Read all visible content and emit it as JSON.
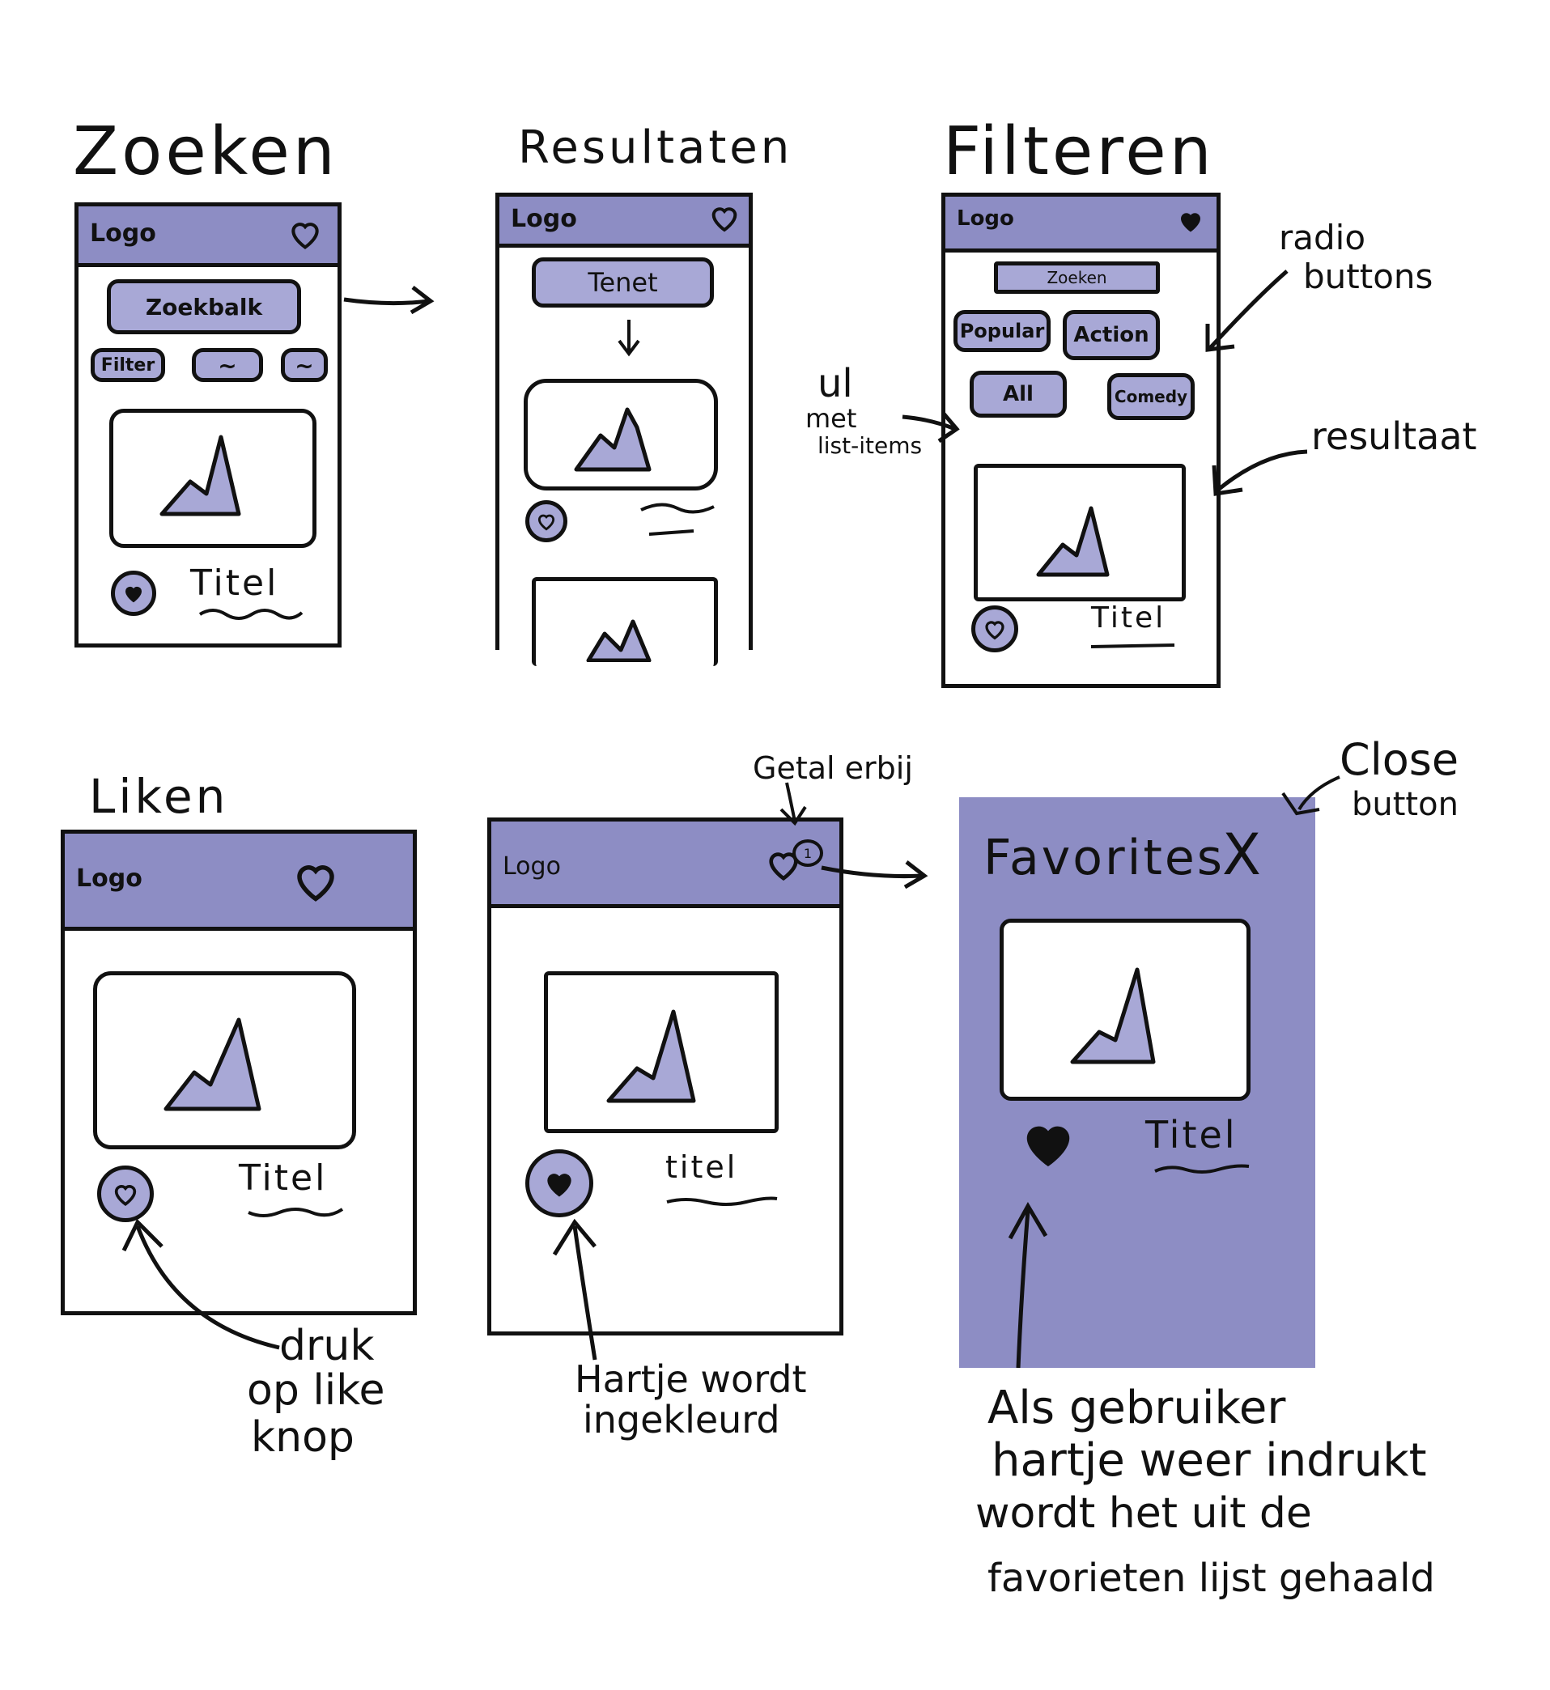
{
  "sections": {
    "zoeken": "Zoeken",
    "resultaten": "Resultaten",
    "filteren": "Filteren",
    "liken": "Liken"
  },
  "common": {
    "logo": "Logo",
    "titel": "Titel"
  },
  "zoeken_screen": {
    "searchbar": "Zoekbalk",
    "filter": "Filter",
    "chip2": "~",
    "chip3": "~"
  },
  "resultaten_screen": {
    "search_value": "Tenet"
  },
  "filteren_screen": {
    "search": "Zoeken",
    "radios": [
      "Popular",
      "Action",
      "All",
      "Comedy"
    ]
  },
  "liked_screen": {
    "titel": "titel"
  },
  "favorites_screen": {
    "title": "Favorites",
    "close": "X"
  },
  "annotations": {
    "radio_buttons": [
      "radio",
      "buttons"
    ],
    "ul": [
      "ul",
      "met",
      "list-items"
    ],
    "resultaat": "resultaat",
    "getal": "Getal erbij",
    "close_button": [
      "Close",
      "button"
    ],
    "druk": [
      "druk",
      "op like",
      "knop"
    ],
    "hartje": [
      "Hartje wordt",
      "ingekleurd"
    ],
    "als_gebruiker": [
      "Als gebruiker",
      "hartje weer indrukt",
      "wordt het uit de",
      "favorieten lijst gehaald"
    ]
  },
  "colors": {
    "accent": "#8d8dc4",
    "accent_light": "#a8a8d6",
    "ink": "#111111"
  }
}
